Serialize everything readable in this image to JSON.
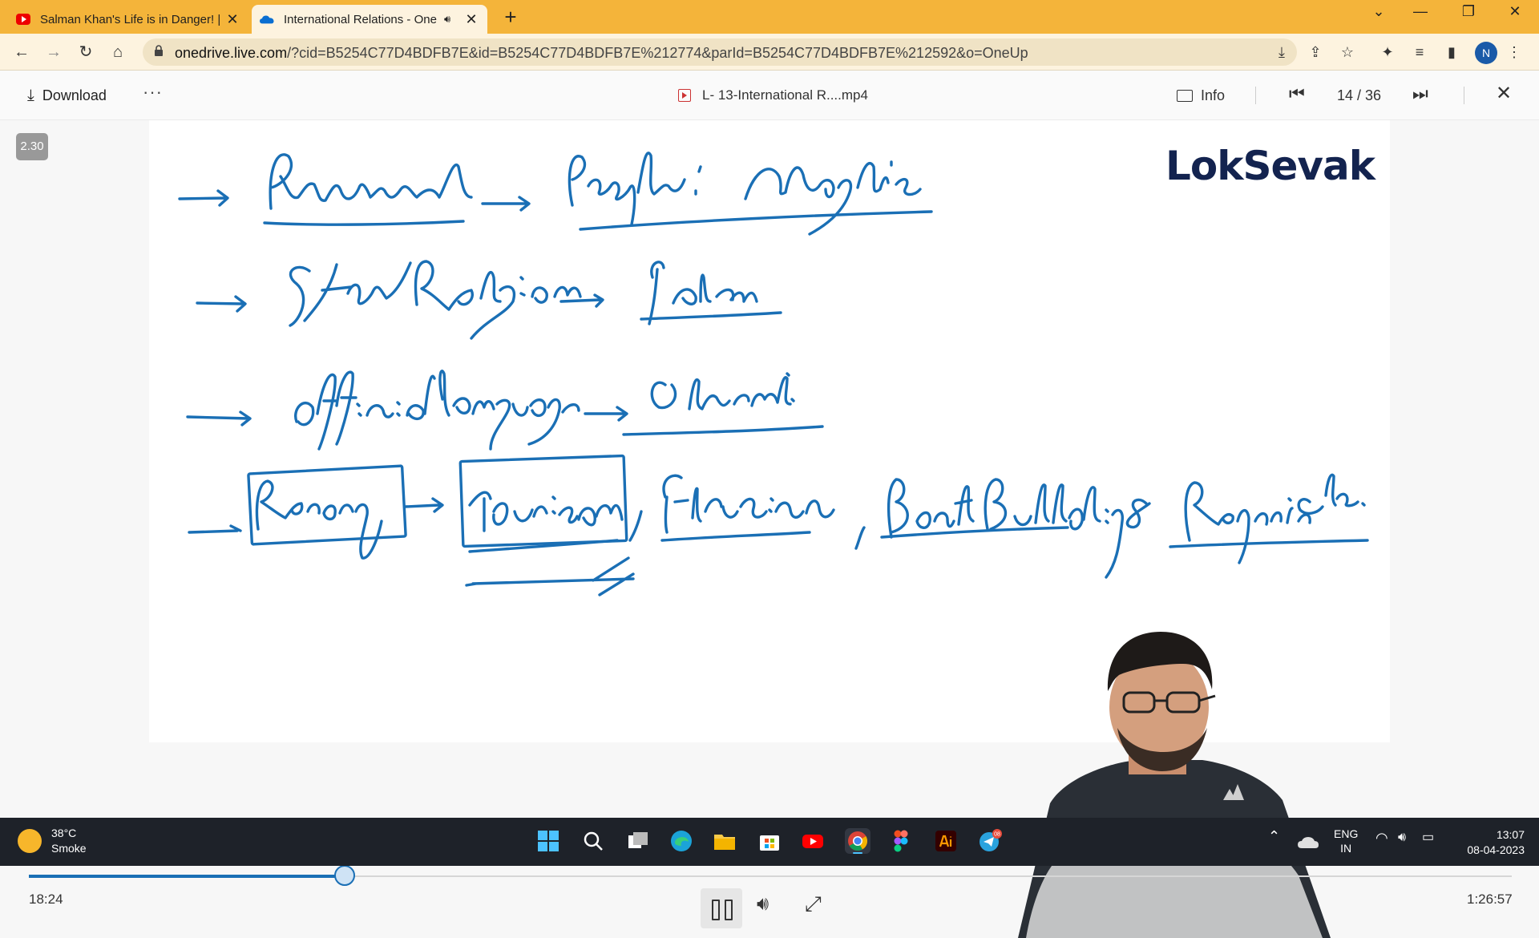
{
  "browser": {
    "tabs": [
      {
        "title": "Salman Khan's Life is in Danger! |",
        "active": false
      },
      {
        "title": "International Relations - One",
        "active": true
      }
    ],
    "new_tab": "+",
    "url_host": "onedrive.live.com",
    "url_rest": "/?cid=B5254C77D4BDFB7E&id=B5254C77D4BDFB7E%212774&parId=B5254C77D4BDFB7E%212592&o=OneUp",
    "profile_initial": "N"
  },
  "viewer": {
    "download_label": "Download",
    "more_label": "···",
    "file_name": "L- 13-International R....mp4",
    "info_label": "Info",
    "counter": "14 / 36",
    "close_label": "✕"
  },
  "video": {
    "speed": "2.30",
    "brand": "LokSevak",
    "current_time": "18:24",
    "total_time": "1:26:57",
    "progress": 0.213
  },
  "taskbar": {
    "temperature": "38°C",
    "weather": "Smoke",
    "lang_top": "ENG",
    "lang_bottom": "IN",
    "time": "13:07",
    "date": "08-04-2023",
    "telegram_badge": "08"
  },
  "colors": {
    "tabstrip": "#f4b43a",
    "ink": "#1a6fb5",
    "brand": "#13234f",
    "taskbar": "#1e2229"
  }
}
